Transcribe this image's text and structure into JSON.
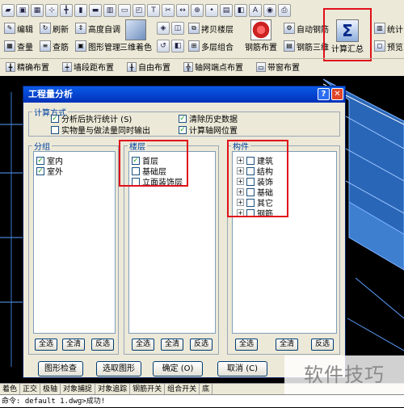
{
  "toolbar": {
    "row1_icons": [
      "folder",
      "floppy",
      "grid",
      "select",
      "axis",
      "column",
      "beam",
      "wall",
      "slab",
      "view",
      "text",
      "scissor",
      "dimension",
      "zoom",
      "point",
      "table",
      "layer",
      "text-tool",
      "render",
      "print"
    ],
    "row2": {
      "edit": "编辑",
      "refresh": "刷新",
      "elevation_auto": "高度自调",
      "query_qty": "查量",
      "query_tendons": "查筋",
      "shape_manage": "图形管理",
      "threed_color": "三维着色",
      "copy_floor": "拷贝楼层",
      "multi_floor_combine": "多层组合",
      "rebar_layout": "钢筋布置",
      "auto_rebar": "自动钢筋",
      "rebar_3d": "钢筋三维",
      "calc_summary": "计算汇总",
      "statistics": "统计",
      "preview": "预览"
    },
    "row3": {
      "precise_layout": "精确布置",
      "wall_span_layout": "墙段距布置",
      "free_layout": "自由布置",
      "axis_point_layout": "轴网端点布置",
      "window_layout": "带窗布置"
    }
  },
  "dialog": {
    "title": "工程量分析",
    "help_btn": "?",
    "close_btn": "✕",
    "calc_method": {
      "legend": "计算方式",
      "options": [
        {
          "label": "分析后执行统计 (S)",
          "checked": true
        },
        {
          "label": "实物量与做法量同时输出",
          "checked": false
        },
        {
          "label": "清除历史数据",
          "checked": true
        },
        {
          "label": "计算轴网位置",
          "checked": true
        }
      ]
    },
    "group": {
      "legend": "分组",
      "items": [
        {
          "label": "室内",
          "checked": true
        },
        {
          "label": "室外",
          "checked": true
        }
      ]
    },
    "floor": {
      "legend": "楼层",
      "items": [
        {
          "label": "首层",
          "checked": true
        },
        {
          "label": "基础层",
          "checked": false
        },
        {
          "label": "立面装饰层",
          "checked": false
        }
      ]
    },
    "component": {
      "legend": "构件",
      "items": [
        {
          "label": "建筑",
          "checked": false
        },
        {
          "label": "结构",
          "checked": false
        },
        {
          "label": "装饰",
          "checked": false
        },
        {
          "label": "基础",
          "checked": false
        },
        {
          "label": "其它",
          "checked": false
        },
        {
          "label": "钢筋",
          "checked": false
        }
      ]
    },
    "select_all": "全选",
    "clear_all": "全清",
    "invert": "反选",
    "btn_check_graphics": "图形检查",
    "btn_select_graphics": "选取图形",
    "btn_ok": "确定 (O)",
    "btn_cancel": "取消 (C)",
    "expander_symbol": "+",
    "check_mark": "✓"
  },
  "statusbar": {
    "cells": [
      "着色",
      "正交",
      "极轴",
      "对象捕捉",
      "对象追踪",
      "钢筋开关",
      "组合开关",
      "底"
    ]
  },
  "cmdline": "命令: default 1.dwg>成功!",
  "watermark": "软件技巧",
  "colors": {
    "highlight_red": "#e0101a",
    "title_blue": "#0031b8",
    "cad_background": "#000000"
  }
}
